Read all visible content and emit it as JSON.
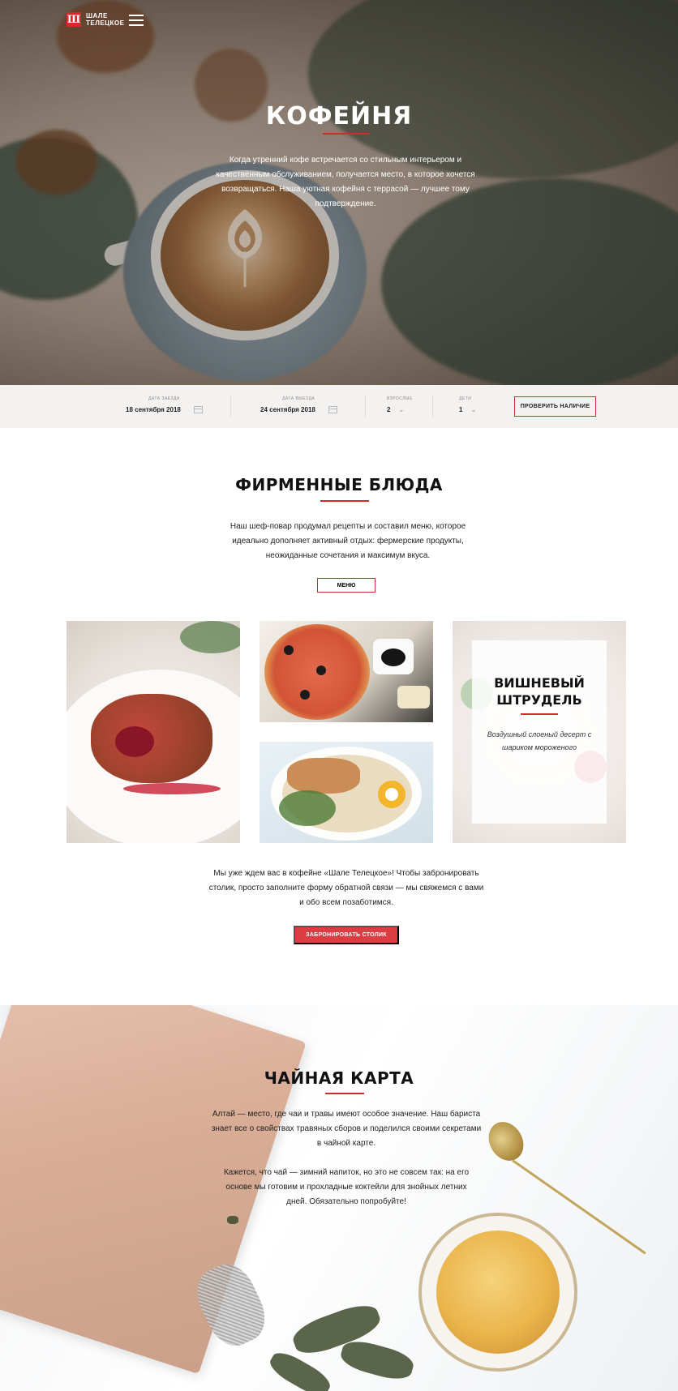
{
  "header": {
    "logo_mark": "Ш",
    "logo_line1": "ШАЛЕ",
    "logo_line2": "ТЕЛЕЦКОЕ"
  },
  "hero": {
    "title": "КОФЕЙНЯ",
    "text": "Когда утренний кофе встречается со стильным интерьером и качественным обслуживанием, получается место, в которое хочется возвращаться. Наша уютная кофейня с террасой — лучшее тому подтверждение."
  },
  "booking": {
    "arrival_label": "Дата заезда",
    "arrival_value": "18 сентября 2018",
    "departure_label": "Дата выезда",
    "departure_value": "24 сентября 2018",
    "adults_label": "Взрослые",
    "adults_value": "2",
    "children_label": "Дети",
    "children_value": "1",
    "check_button": "ПРОВЕРИТЬ НАЛИЧИЕ"
  },
  "dishes": {
    "title": "ФИРМЕННЫЕ БЛЮДА",
    "text": "Наш шеф-повар продумал рецепты и составил меню, которое идеально дополняет активный отдых: фермерские продукты, неожиданные сочетания и максимум вкуса.",
    "menu_button": "МЕНЮ",
    "card_title_1": "ВИШНЕВЫЙ",
    "card_title_2": "ШТРУДЕЛЬ",
    "card_text": "Воздушный слоеный десерт с шариком мороженого",
    "reserve_text": "Мы уже ждем вас в кофейне «Шале Телецкое»! Чтобы забронировать столик, просто заполните форму обратной связи — мы свяжемся с вами и обо всем позаботимся.",
    "reserve_button": "ЗАБРОНИРОВАТЬ СТОЛИК"
  },
  "tea": {
    "title": "ЧАЙНАЯ КАРТА",
    "text1": "Алтай — место, где чаи и травы имеют особое значение. Наш бариста знает все о свойствах травяных сборов и поделился своими секретами в чайной карте.",
    "text2": "Кажется, что чай — зимний напиток, но это не совсем так: на его основе мы готовим и прохладные коктейли для знойных летних дней. Обязательно попробуйте!"
  },
  "colors": {
    "accent": "#d7262c",
    "button_fill": "#dc3d43",
    "booking_bg": "#f4f2f0"
  }
}
